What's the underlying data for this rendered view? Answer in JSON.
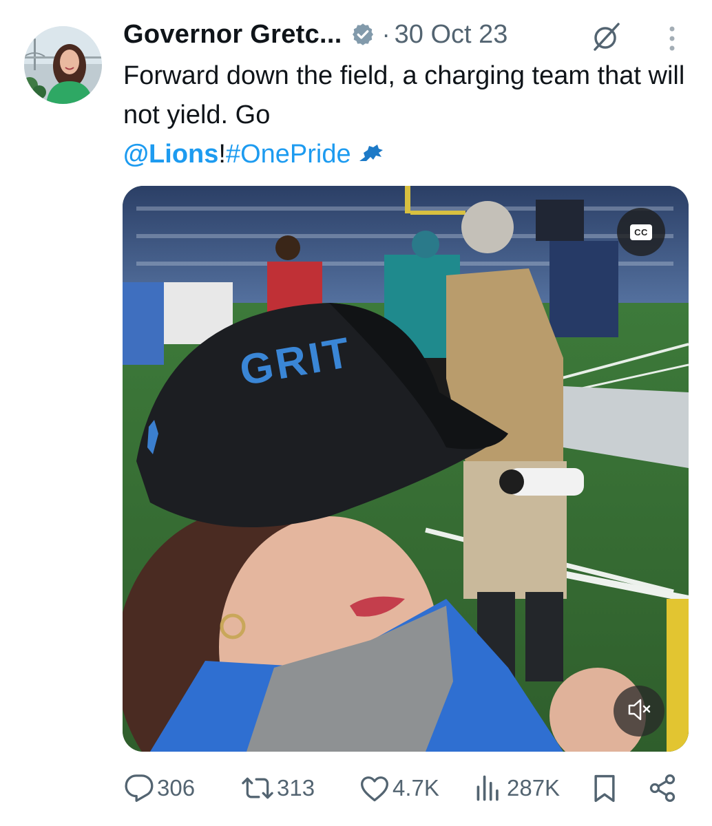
{
  "author": {
    "display_name": "Governor Gretc...",
    "verified_badge": "verified-badge-icon",
    "separator": "·",
    "date": "30 Oct 23"
  },
  "tweet": {
    "text_plain": "Forward down the field, a charging team that will not yield. Go",
    "mention": "@Lions",
    "exclamation": "!",
    "hashtag": "#OnePride"
  },
  "media": {
    "type": "video",
    "cap_text": "GRIT",
    "captions_label": "CC",
    "mute_icon": "volume-muted-icon"
  },
  "actions": {
    "replies": "306",
    "reposts": "313",
    "likes": "4.7K",
    "views": "287K"
  },
  "colors": {
    "text": "#0f1419",
    "secondary": "#536471",
    "link": "#1d9bf0"
  }
}
